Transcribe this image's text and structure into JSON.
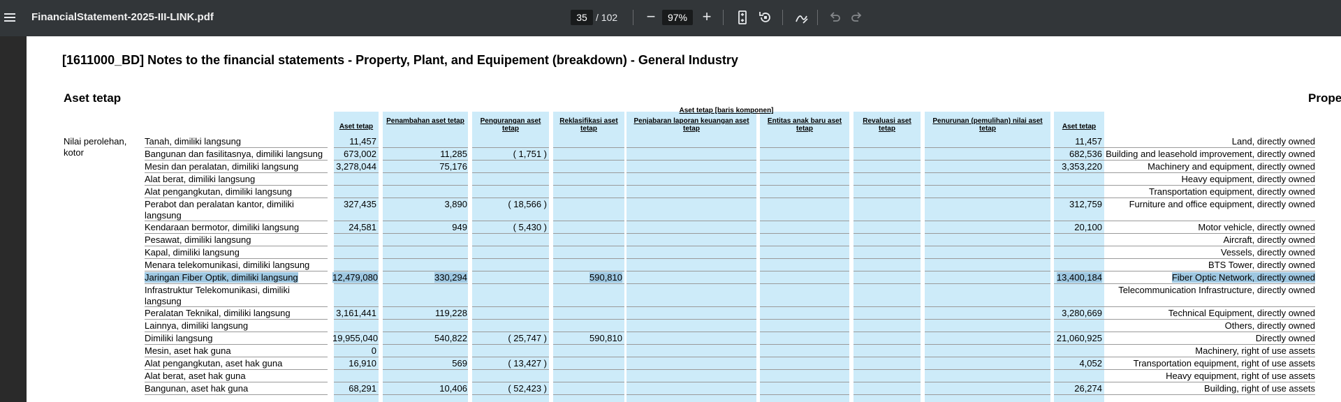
{
  "toolbar": {
    "file_name": "FinancialStatement-2025-III-LINK.pdf",
    "page_current": "35",
    "page_total": "/ 102",
    "zoom": "97%",
    "zoom_out": "−",
    "zoom_in": "+"
  },
  "document": {
    "title": "[1611000_BD] Notes to the financial statements - Property, Plant, and Equipement (breakdown) - General Industry",
    "section_title": "Aset tetap",
    "section_title_en_partial": "Prope",
    "group_header": "Aset tetap [baris komponen]",
    "columns": [
      "Aset tetap",
      "Penambahan aset tetap",
      "Pengurangan aset tetap",
      "Reklasifikasi aset tetap",
      "Penjabaran laporan keuangan aset tetap",
      "Entitas anak baru aset tetap",
      "Revaluasi aset tetap",
      "Penurunan (pemulihan) nilai aset tetap",
      "Aset tetap"
    ],
    "row_group_label": "Nilai perolehan, kotor",
    "rows": [
      {
        "id": "Tanah, dimiliki langsung",
        "v": [
          "11,457",
          "",
          "",
          "",
          "",
          "",
          "",
          "",
          "11,457"
        ],
        "en": "Land, directly owned"
      },
      {
        "id": "Bangunan dan fasilitasnya, dimiliki langsung",
        "v": [
          "673,002",
          "11,285",
          "( 1,751 )",
          "",
          "",
          "",
          "",
          "",
          "682,536"
        ],
        "en": "Building and leasehold improvement, directly owned"
      },
      {
        "id": "Mesin dan peralatan, dimiliki langsung",
        "v": [
          "3,278,044",
          "75,176",
          "",
          "",
          "",
          "",
          "",
          "",
          "3,353,220"
        ],
        "en": "Machinery and equipment, directly owned"
      },
      {
        "id": "Alat berat, dimiliki langsung",
        "v": [
          "",
          "",
          "",
          "",
          "",
          "",
          "",
          "",
          ""
        ],
        "en": "Heavy equipment, directly owned"
      },
      {
        "id": "Alat pengangkutan, dimiliki langsung",
        "v": [
          "",
          "",
          "",
          "",
          "",
          "",
          "",
          "",
          ""
        ],
        "en": "Transportation equipment, directly owned"
      },
      {
        "id": "Perabot dan peralatan kantor, dimiliki langsung",
        "v": [
          "327,435",
          "3,890",
          "( 18,566 )",
          "",
          "",
          "",
          "",
          "",
          "312,759"
        ],
        "en": "Furniture and office equipment, directly owned"
      },
      {
        "id": "Kendaraan bermotor, dimiliki langsung",
        "v": [
          "24,581",
          "949",
          "( 5,430 )",
          "",
          "",
          "",
          "",
          "",
          "20,100"
        ],
        "en": "Motor vehicle, directly owned"
      },
      {
        "id": "Pesawat, dimiliki langsung",
        "v": [
          "",
          "",
          "",
          "",
          "",
          "",
          "",
          "",
          ""
        ],
        "en": "Aircraft, directly owned"
      },
      {
        "id": "Kapal, dimiliki langsung",
        "v": [
          "",
          "",
          "",
          "",
          "",
          "",
          "",
          "",
          ""
        ],
        "en": "Vessels, directly owned"
      },
      {
        "id": "Menara telekomunikasi, dimiliki langsung",
        "v": [
          "",
          "",
          "",
          "",
          "",
          "",
          "",
          "",
          ""
        ],
        "en": "BTS Tower, directly owned"
      },
      {
        "id": "Jaringan Fiber Optik, dimiliki langsung",
        "v": [
          "12,479,080",
          "330,294",
          "",
          "590,810",
          "",
          "",
          "",
          "",
          "13,400,184"
        ],
        "en": "Fiber Optic Network, directly owned",
        "highlight": true
      },
      {
        "id": "Infrastruktur Telekomunikasi, dimiliki langsung",
        "v": [
          "",
          "",
          "",
          "",
          "",
          "",
          "",
          "",
          ""
        ],
        "en": "Telecommunication Infrastructure, directly owned"
      },
      {
        "id": "Peralatan Teknikal, dimiliki langsung",
        "v": [
          "3,161,441",
          "119,228",
          "",
          "",
          "",
          "",
          "",
          "",
          "3,280,669"
        ],
        "en": "Technical Equipment, directly owned"
      },
      {
        "id": "Lainnya, dimiliki langsung",
        "v": [
          "",
          "",
          "",
          "",
          "",
          "",
          "",
          "",
          ""
        ],
        "en": "Others, directly owned"
      },
      {
        "id": "Dimiliki langsung",
        "v": [
          "19,955,040",
          "540,822",
          "( 25,747 )",
          "590,810",
          "",
          "",
          "",
          "",
          "21,060,925"
        ],
        "en": "Directly owned"
      },
      {
        "id": "Mesin, aset hak guna",
        "v": [
          "0",
          "",
          "",
          "",
          "",
          "",
          "",
          "",
          ""
        ],
        "en": "Machinery, right of use assets"
      },
      {
        "id": "Alat pengangkutan, aset hak guna",
        "v": [
          "16,910",
          "569",
          "( 13,427 )",
          "",
          "",
          "",
          "",
          "",
          "4,052"
        ],
        "en": "Transportation equipment, right of use assets"
      },
      {
        "id": "Alat berat, aset hak guna",
        "v": [
          "",
          "",
          "",
          "",
          "",
          "",
          "",
          "",
          ""
        ],
        "en": "Heavy equipment, right of use assets"
      },
      {
        "id": "Bangunan, aset hak guna",
        "v": [
          "68,291",
          "10,406",
          "( 52,423 )",
          "",
          "",
          "",
          "",
          "",
          "26,274"
        ],
        "en": "Building, right of use assets"
      }
    ]
  }
}
